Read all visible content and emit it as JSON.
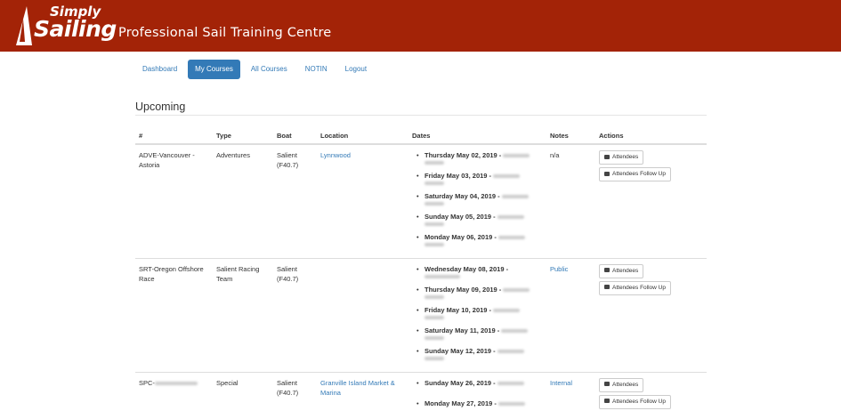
{
  "header": {
    "logo_top": "Simply",
    "logo_bottom": "Sailing",
    "tagline": "Professional Sail Training Centre",
    "bg_color": "#a32307"
  },
  "nav": {
    "items": [
      "Dashboard",
      "My Courses",
      "All Courses",
      "NOTIN",
      "Logout"
    ],
    "active": "My Courses"
  },
  "section_title": "Upcoming",
  "table": {
    "headers": [
      "#",
      "Type",
      "Boat",
      "Location",
      "Dates",
      "Notes",
      "Actions"
    ],
    "rows": [
      {
        "id": "ADVE-Vancouver - Astoria",
        "type": "Adventures",
        "boat": "Salient (F40.7)",
        "location": "Lynnwood",
        "dates": [
          "Thursday May 02, 2019 -",
          "Friday May 03, 2019 -",
          "Saturday May 04, 2019 -",
          "Sunday May 05, 2019 -",
          "Monday May 06, 2019 -"
        ],
        "notes": "n/a"
      },
      {
        "id": "SRT-Oregon Offshore Race",
        "type": "Salient Racing Team",
        "boat": "Salient (F40.7)",
        "location": "",
        "dates": [
          "Wednesday May 08, 2019 -",
          "Thursday May 09, 2019 -",
          "Friday May 10, 2019 -",
          "Saturday May 11, 2019 -",
          "Sunday May 12, 2019 -"
        ],
        "notes": "Public"
      },
      {
        "id": "SPC-",
        "type": "Special",
        "boat": "Salient (F40.7)",
        "location": "Granville Island Market & Marina",
        "dates": [
          "Sunday May 26, 2019 -",
          "Monday May 27, 2019 -"
        ],
        "notes": "Internal"
      }
    ],
    "actions": {
      "attendees": "Attendees",
      "follow_up": "Attendees Follow Up"
    }
  }
}
